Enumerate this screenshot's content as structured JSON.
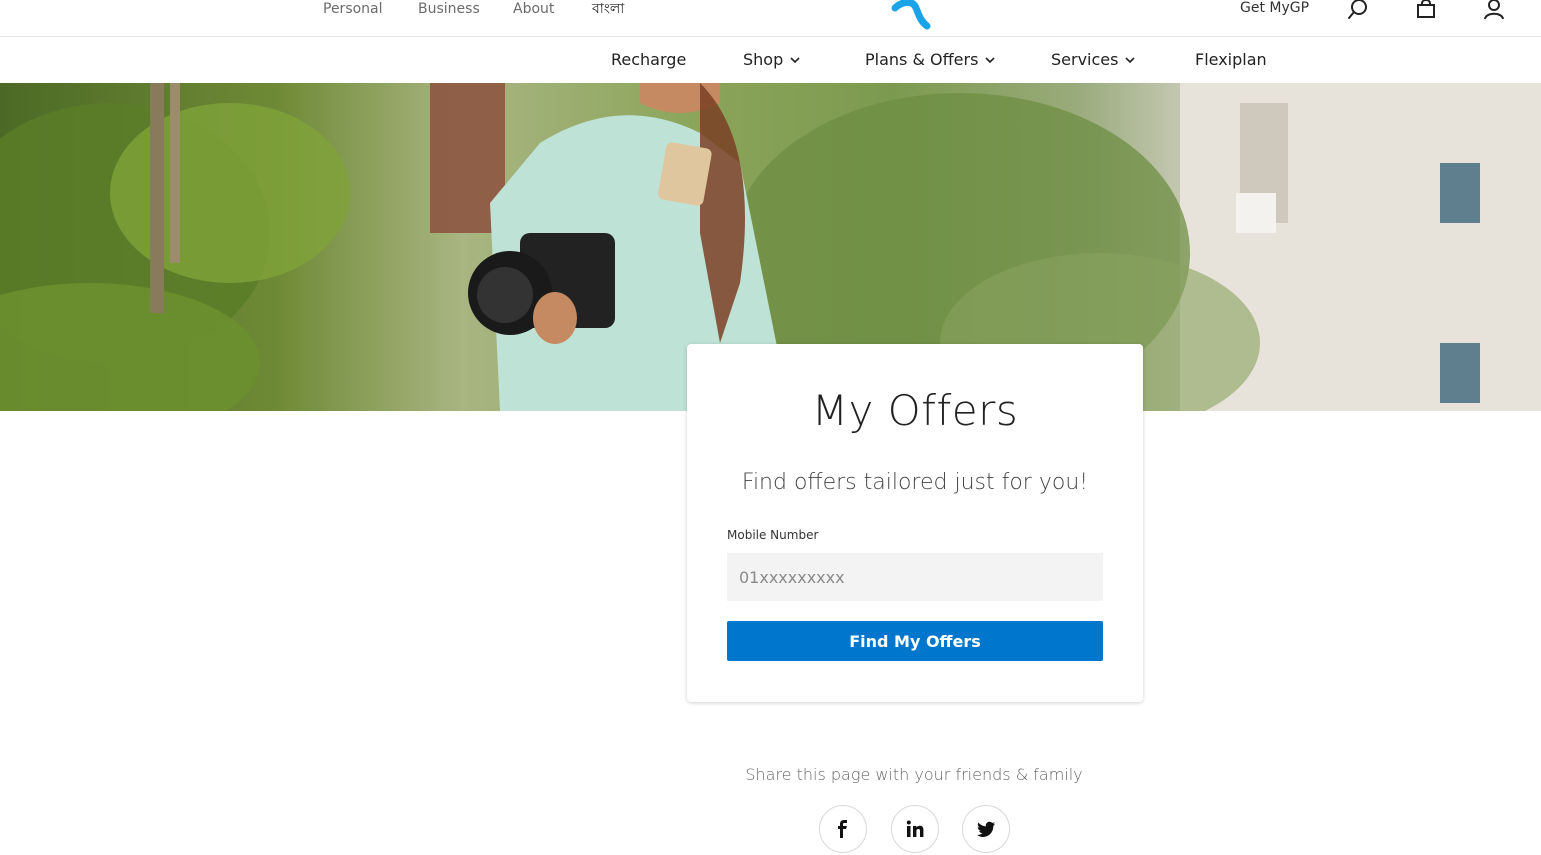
{
  "topbar": {
    "links": [
      "Personal",
      "Business",
      "About",
      "বাংলা"
    ],
    "get_mygp": "Get MyGP",
    "brand_color": "#1aa3e8"
  },
  "nav": {
    "items": [
      {
        "label": "Recharge",
        "has_dropdown": false
      },
      {
        "label": "Shop",
        "has_dropdown": true
      },
      {
        "label": "Plans & Offers",
        "has_dropdown": true
      },
      {
        "label": "Services",
        "has_dropdown": true
      },
      {
        "label": "Flexiplan",
        "has_dropdown": false
      }
    ]
  },
  "card": {
    "title": "My Offers",
    "subtitle": "Find offers tailored just for you!",
    "field_label": "Mobile Number",
    "field_placeholder": "01xxxxxxxxx",
    "field_value": "",
    "button_label": "Find My Offers",
    "button_color": "#0077cc"
  },
  "share": {
    "text": "Share this page with your friends & family",
    "networks": [
      "facebook-icon",
      "linkedin-icon",
      "twitter-icon"
    ]
  }
}
